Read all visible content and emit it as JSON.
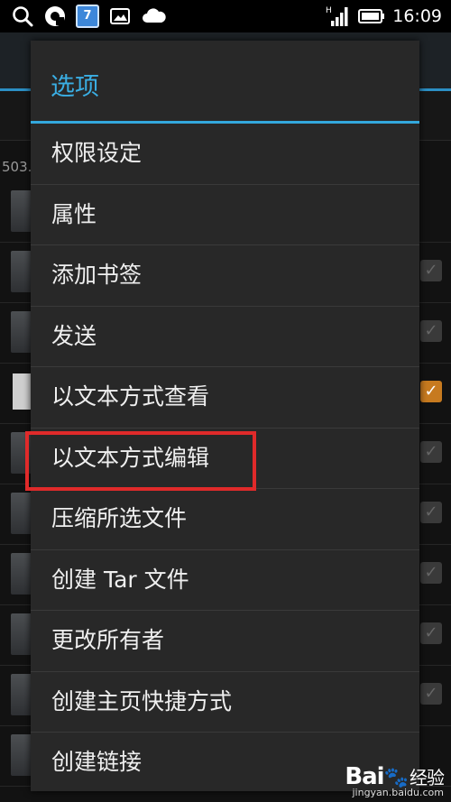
{
  "status_bar": {
    "time": "16:09",
    "calendar_day": "7",
    "signal_label": "H"
  },
  "background": {
    "path_fragment": "503."
  },
  "dialog": {
    "title": "选项",
    "items": [
      {
        "label": "权限设定"
      },
      {
        "label": "属性"
      },
      {
        "label": "添加书签"
      },
      {
        "label": "发送"
      },
      {
        "label": "以文本方式查看"
      },
      {
        "label": "以文本方式编辑"
      },
      {
        "label": "压缩所选文件"
      },
      {
        "label": "创建 Tar 文件"
      },
      {
        "label": "更改所有者"
      },
      {
        "label": "创建主页快捷方式"
      },
      {
        "label": "创建链接"
      }
    ],
    "highlighted_item": "以文本方式编辑"
  },
  "watermark": {
    "logo": "Bai",
    "logo_suffix": "经验",
    "url": "jingyan.baidu.com"
  },
  "colors": {
    "accent": "#33a8dd",
    "highlight": "#e02a2a",
    "dialog_bg": "#282828"
  }
}
